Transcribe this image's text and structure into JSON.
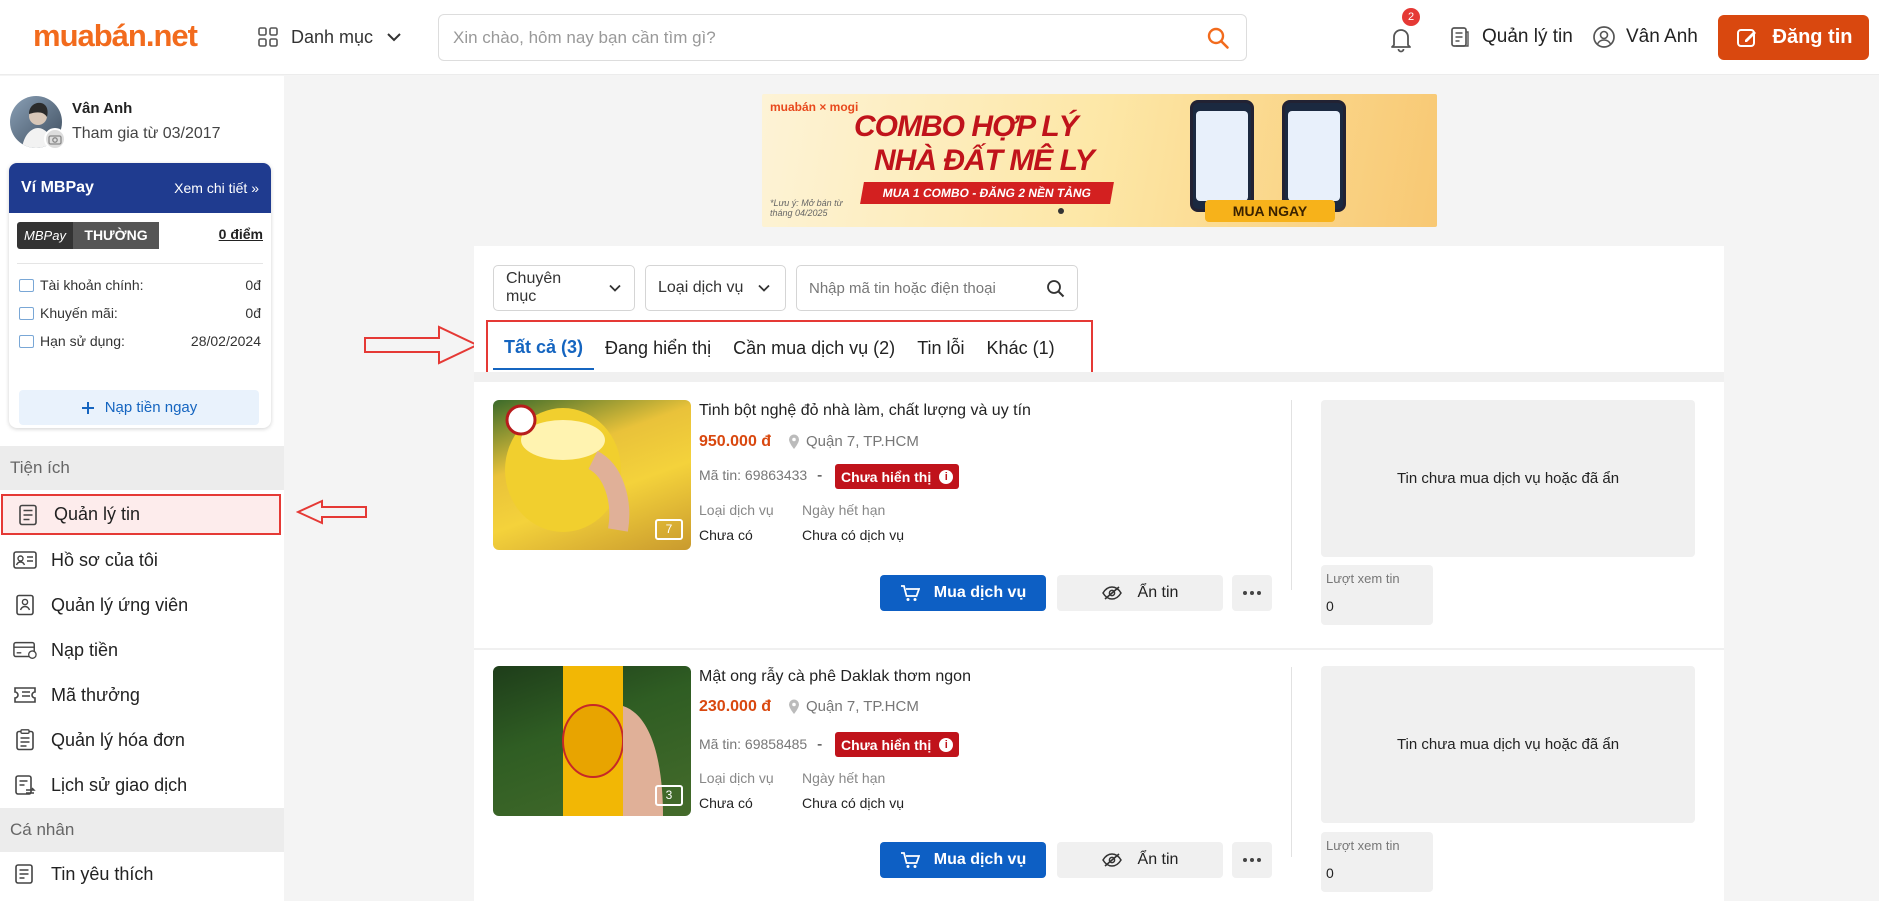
{
  "header": {
    "logo_main": "muabán",
    "logo_suffix": ".net",
    "category_label": "Danh mục",
    "search_placeholder": "Xin chào, hôm nay bạn cần tìm gì?",
    "notification_count": "2",
    "manage_label": "Quản lý tin",
    "user_label": "Vân Anh",
    "post_label": "Đăng tin",
    "accent_color": "#d9480f"
  },
  "profile": {
    "name": "Vân Anh",
    "joined": "Tham gia từ 03/2017"
  },
  "wallet": {
    "title": "Ví MBPay",
    "details_link": "Xem chi tiết",
    "tier_brand": "MBPay",
    "tier_name": "THƯỜNG",
    "points": "0 điểm",
    "rows": [
      {
        "label": "Tài khoản chính:",
        "value": "0đ"
      },
      {
        "label": "Khuyến mãi:",
        "value": "0đ"
      },
      {
        "label": "Hạn sử dụng:",
        "value": "28/02/2024"
      }
    ],
    "topup_label": "Nạp tiền ngay"
  },
  "sidebar": {
    "section_utilities": "Tiện ích",
    "section_personal": "Cá nhân",
    "items": [
      {
        "label": "Quản lý tin",
        "icon": "document-list-icon"
      },
      {
        "label": "Hồ sơ của tôi",
        "icon": "id-card-icon"
      },
      {
        "label": "Quản lý ứng viên",
        "icon": "candidate-icon"
      },
      {
        "label": "Nạp tiền",
        "icon": "payment-card-icon"
      },
      {
        "label": "Mã thưởng",
        "icon": "voucher-icon"
      },
      {
        "label": "Quản lý hóa đơn",
        "icon": "invoice-icon"
      },
      {
        "label": "Lịch sử giao dịch",
        "icon": "transaction-history-icon"
      }
    ],
    "personal_items": [
      {
        "label": "Tin yêu thích",
        "icon": "favorite-list-icon"
      }
    ]
  },
  "banner": {
    "brand": "muabán × mogi",
    "line1": "COMBO HỢP LÝ",
    "line2": "NHÀ ĐẤT MÊ LY",
    "strip": "MUA 1 COMBO - ĐĂNG 2 NỀN TẢNG",
    "note": "*Lưu ý: Mở bán từ tháng 04/2025",
    "cta": "MUA NGAY"
  },
  "filters": {
    "category": "Chuyên mục",
    "service_type": "Loại dịch vụ",
    "search_placeholder": "Nhập mã tin hoặc điện thoại"
  },
  "tabs": [
    {
      "label": "Tất cả (3)",
      "active": true
    },
    {
      "label": "Đang hiển thị",
      "active": false
    },
    {
      "label": "Cần mua dịch vụ (2)",
      "active": false
    },
    {
      "label": "Tin lỗi",
      "active": false
    },
    {
      "label": "Khác (1)",
      "active": false
    }
  ],
  "listings": [
    {
      "title": "Tinh bột nghệ đỏ nhà làm, chất lượng và uy tín",
      "price": "950.000 đ",
      "location": "Quận 7, TP.HCM",
      "id_text": "Mã tin: 69863433",
      "dash": "-",
      "status": "Chưa hiển thị",
      "service_type_label": "Loại dịch vụ",
      "service_type_value": "Chưa có",
      "expiry_label": "Ngày hết hạn",
      "expiry_value": "Chưa có dịch vụ",
      "photo_count": "7",
      "buy_label": "Mua dịch vụ",
      "hide_label": "Ẩn tin",
      "promo_text": "Tin chưa mua dịch vụ hoặc đã ẩn",
      "views_label": "Lượt xem tin",
      "views_value": "0"
    },
    {
      "title": "Mật ong rẫy cà phê Daklak thơm ngon",
      "price": "230.000 đ",
      "location": "Quận 7, TP.HCM",
      "id_text": "Mã tin: 69858485",
      "dash": "-",
      "status": "Chưa hiển thị",
      "service_type_label": "Loại dịch vụ",
      "service_type_value": "Chưa có",
      "expiry_label": "Ngày hết hạn",
      "expiry_value": "Chưa có dịch vụ",
      "photo_count": "3",
      "buy_label": "Mua dịch vụ",
      "hide_label": "Ẩn tin",
      "promo_text": "Tin chưa mua dịch vụ hoặc đã ẩn",
      "views_label": "Lượt xem tin",
      "views_value": "0"
    }
  ]
}
